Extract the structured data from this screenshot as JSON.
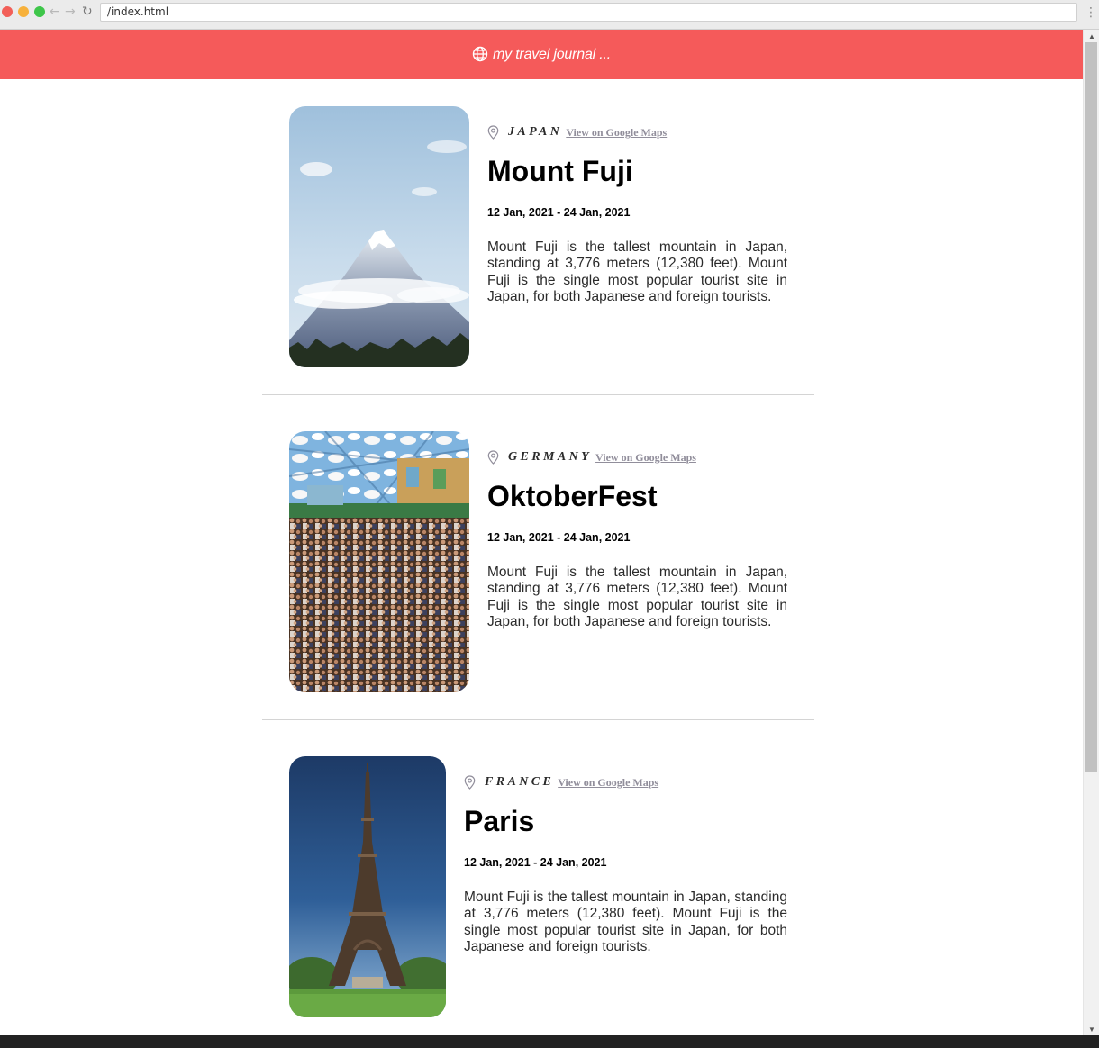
{
  "browser": {
    "url": "/index.html"
  },
  "header": {
    "icon": "globe-icon",
    "title": "my travel journal ..."
  },
  "colors": {
    "header_bg": "#f55a5a",
    "link": "#918e9b"
  },
  "entries": [
    {
      "country": "JAPAN",
      "maps_link": "View on Google Maps",
      "title": "Mount Fuji",
      "dates": "12 Jan, 2021 - 24 Jan, 2021",
      "description": "Mount Fuji is the tallest mountain in Japan, standing at 3,776 meters (12,380 feet). Mount Fuji is the single most popular tourist site in Japan, for both Japanese and foreign tourists."
    },
    {
      "country": "GERMANY",
      "maps_link": "View on Google Maps",
      "title": "OktoberFest",
      "dates": "12 Jan, 2021 - 24 Jan, 2021",
      "description": "Mount Fuji is the tallest mountain in Japan, standing at 3,776 meters (12,380 feet). Mount Fuji is the single most popular tourist site in Japan, for both Japanese and foreign tourists."
    },
    {
      "country": "FRANCE",
      "maps_link": "View on Google Maps",
      "title": "Paris",
      "dates": "12 Jan, 2021 - 24 Jan, 2021",
      "description": "Mount Fuji is the tallest mountain in Japan, standing at 3,776 meters (12,380 feet). Mount Fuji is the single most popular tourist site in Japan, for both Japanese and foreign tourists."
    }
  ]
}
